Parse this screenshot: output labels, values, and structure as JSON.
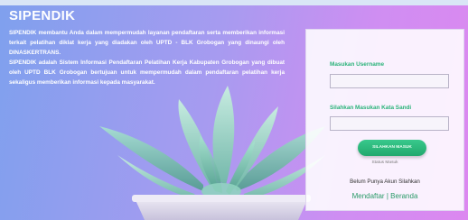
{
  "app": {
    "title": "SIPENDIK",
    "description_1": "SIPENDIK membantu Anda dalam mempermudah layanan pendaftaran serta memberikan informasi terkait pelatihan diklat kerja yang diadakan oleh UPTD - BLK Grobogan yang dinaungi oleh DINASKERTRANS.",
    "description_2": "SIPENDIK adalah Sistem Informasi Pendaftaran Pelatihan Kerja Kabupaten Grobogan yang dibuat oleh UPTD BLK Grobogan bertujuan untuk mempermudah dalam pendaftaran pelatihan kerja sekaligus memberikan informasi kepada masyarakat."
  },
  "login": {
    "username_label": "Masukan Username",
    "username_value": "",
    "password_label": "Silahkan Masukan Kata Sandi",
    "password_value": "",
    "submit_label": "SILAHKAN MASUK",
    "status_text": "Status Masuk",
    "no_account_text": "Belum Punya Akun Silahkan",
    "register_link": "Mendaftar",
    "separator": "|",
    "home_link": "Beranda"
  },
  "colors": {
    "accent": "#2bb37a",
    "gradient_start": "#7fa0ee",
    "gradient_end": "#dc88f0"
  }
}
